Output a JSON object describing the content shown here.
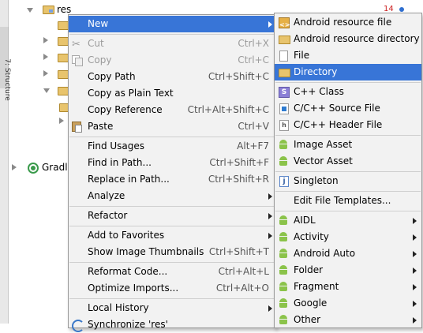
{
  "side_panel": {
    "label": "7: Structure"
  },
  "tree": {
    "root_label": "res",
    "gradle_label": "Gradle"
  },
  "corner": {
    "number": "14"
  },
  "context_menu": {
    "items": [
      {
        "label": "New",
        "shortcut": "",
        "mnemonic_index": 0,
        "submenu": true,
        "selected": true,
        "icon": ""
      },
      {
        "label": "Cut",
        "shortcut": "Ctrl+X",
        "disabled": true,
        "icon": "scissors-icon"
      },
      {
        "label": "Copy",
        "shortcut": "Ctrl+C",
        "disabled": true,
        "icon": "copy-icon"
      },
      {
        "label": "Copy Path",
        "shortcut": "Ctrl+Shift+C",
        "icon": ""
      },
      {
        "label": "Copy as Plain Text",
        "shortcut": "",
        "icon": ""
      },
      {
        "label": "Copy Reference",
        "shortcut": "Ctrl+Alt+Shift+C",
        "icon": ""
      },
      {
        "label": "Paste",
        "shortcut": "Ctrl+V",
        "icon": "paste-icon"
      },
      {
        "label": "Find Usages",
        "shortcut": "Alt+F7",
        "icon": ""
      },
      {
        "label": "Find in Path...",
        "shortcut": "Ctrl+Shift+F",
        "icon": ""
      },
      {
        "label": "Replace in Path...",
        "shortcut": "Ctrl+Shift+R",
        "icon": ""
      },
      {
        "label": "Analyze",
        "shortcut": "",
        "submenu": true,
        "icon": ""
      },
      {
        "label": "Refactor",
        "shortcut": "",
        "submenu": true,
        "icon": ""
      },
      {
        "label": "Add to Favorites",
        "shortcut": "",
        "submenu": true,
        "icon": ""
      },
      {
        "label": "Show Image Thumbnails",
        "shortcut": "Ctrl+Shift+T",
        "icon": ""
      },
      {
        "label": "Reformat Code...",
        "shortcut": "Ctrl+Alt+L",
        "icon": ""
      },
      {
        "label": "Optimize Imports...",
        "shortcut": "Ctrl+Alt+O",
        "icon": ""
      },
      {
        "label": "Local History",
        "shortcut": "",
        "submenu": true,
        "icon": ""
      },
      {
        "label": "Synchronize 'res'",
        "shortcut": "",
        "icon": "sync-icon"
      }
    ]
  },
  "new_submenu": {
    "items": [
      {
        "label": "Android resource file",
        "icon": "resource-file-icon"
      },
      {
        "label": "Android resource directory",
        "icon": "folder-icon"
      },
      {
        "label": "File",
        "icon": "file-icon"
      },
      {
        "label": "Directory",
        "icon": "folder-icon",
        "selected": true
      },
      {
        "label": "C++ Class",
        "icon": "class-s-icon"
      },
      {
        "label": "C/C++ Source File",
        "icon": "cpp-file-icon"
      },
      {
        "label": "C/C++ Header File",
        "icon": "header-file-icon"
      },
      {
        "label": "Image Asset",
        "icon": "android-icon"
      },
      {
        "label": "Vector Asset",
        "icon": "android-icon"
      },
      {
        "label": "Singleton",
        "icon": "java-file-icon"
      },
      {
        "label": "Edit File Templates...",
        "icon": ""
      },
      {
        "label": "AIDL",
        "icon": "android-icon",
        "submenu": true
      },
      {
        "label": "Activity",
        "icon": "android-icon",
        "submenu": true
      },
      {
        "label": "Android Auto",
        "icon": "android-icon",
        "submenu": true
      },
      {
        "label": "Folder",
        "icon": "android-icon",
        "submenu": true
      },
      {
        "label": "Fragment",
        "icon": "android-icon",
        "submenu": true
      },
      {
        "label": "Google",
        "icon": "android-icon",
        "submenu": true
      },
      {
        "label": "Other",
        "icon": "android-icon",
        "submenu": true
      }
    ]
  },
  "colors": {
    "selection": "#3875d7",
    "menu_background": "#f2f2f2",
    "android_green": "#8bc34a"
  }
}
